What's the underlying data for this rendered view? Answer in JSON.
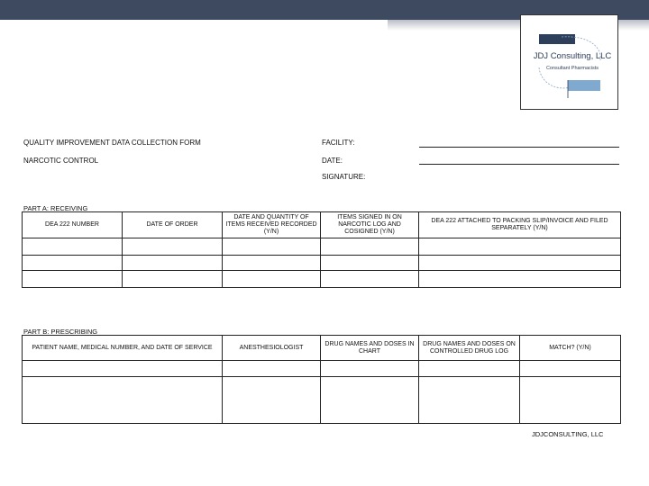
{
  "logo": {
    "name": "JDJ Consulting, LLC",
    "tagline": "Consultant Pharmacists"
  },
  "form": {
    "title": "QUALITY IMPROVEMENT DATA COLLECTION FORM",
    "subtitle": "NARCOTIC CONTROL",
    "facility_label": "FACILITY:",
    "date_label": "DATE:",
    "signature_label": "SIGNATURE:"
  },
  "part_a": {
    "label": "PART A: RECEIVING",
    "headers": [
      "DEA 222 NUMBER",
      "DATE OF ORDER",
      "DATE AND QUANTITY OF ITEMS RECEIVED RECORDED (Y/N)",
      "ITEMS SIGNED IN ON NARCOTIC LOG AND COSIGNED (Y/N)",
      "DEA 222 ATTACHED TO PACKING SLIP/INVOICE AND FILED SEPARATELY (Y/N)"
    ]
  },
  "part_b": {
    "label": "PART B: PRESCRIBING",
    "headers": [
      "PATIENT NAME, MEDICAL NUMBER, AND DATE OF SERVICE",
      "ANESTHESIOLOGIST",
      "DRUG NAMES AND DOSES IN CHART",
      "DRUG NAMES AND DOSES ON CONTROLLED DRUG LOG",
      "MATCH? (Y/N)"
    ]
  },
  "footer": "JDJCONSULTING, LLC"
}
